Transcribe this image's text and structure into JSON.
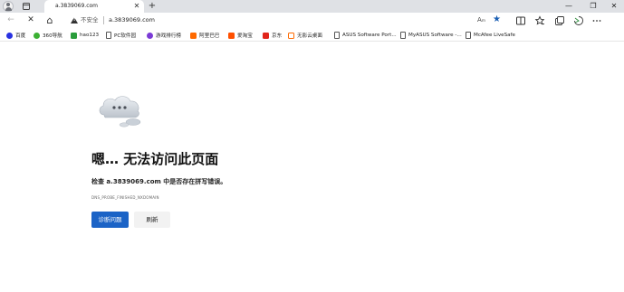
{
  "tab": {
    "title": "a.3839069.com",
    "close": "✕",
    "new_tab": "+"
  },
  "window": {
    "minimize": "—",
    "maximize": "❐",
    "close": "✕"
  },
  "toolbar": {
    "back": "←",
    "stop": "✕",
    "home": "⌂",
    "security_label": "不安全",
    "url": "a.3839069.com",
    "read_aloud": "Aₘ"
  },
  "bookmarks": [
    {
      "label": "百度",
      "icon": "baidu-icon",
      "color": "#2932e1"
    },
    {
      "label": "360导航",
      "icon": "360-icon",
      "color": "#3cb033"
    },
    {
      "label": "hao123",
      "icon": "hao123-icon",
      "color": "#2a9d3b"
    },
    {
      "label": "PC软件园",
      "icon": "page-icon",
      "color": "#555555"
    },
    {
      "label": "游戏排行榜",
      "icon": "game-icon",
      "color": "#7b3bd6"
    },
    {
      "label": "阿里巴巴",
      "icon": "alibaba-icon",
      "color": "#ff6a00"
    },
    {
      "label": "爱淘宝",
      "icon": "taobao-icon",
      "color": "#ff5000"
    },
    {
      "label": "京东",
      "icon": "jd-icon",
      "color": "#e1251b"
    },
    {
      "label": "无影云桌面",
      "icon": "cloud-desktop-icon",
      "color": "#ff6a00"
    },
    {
      "label": "ASUS Software Port...",
      "icon": "page-icon",
      "color": "#555555"
    },
    {
      "label": "MyASUS Software -...",
      "icon": "page-icon",
      "color": "#555555"
    },
    {
      "label": "McAfee LiveSafe",
      "icon": "page-icon",
      "color": "#555555"
    }
  ],
  "error": {
    "title": "嗯… 无法访问此页面",
    "description": "检查 a.3839069.com 中是否存在拼写错误。",
    "code": "DNS_PROBE_FINISHED_NXDOMAIN",
    "primary_button": "诊断问题",
    "secondary_button": "刷新"
  },
  "colors": {
    "accent": "#1b63c6",
    "tabstrip": "#dfe1e5",
    "star": "#1a5fb4"
  }
}
